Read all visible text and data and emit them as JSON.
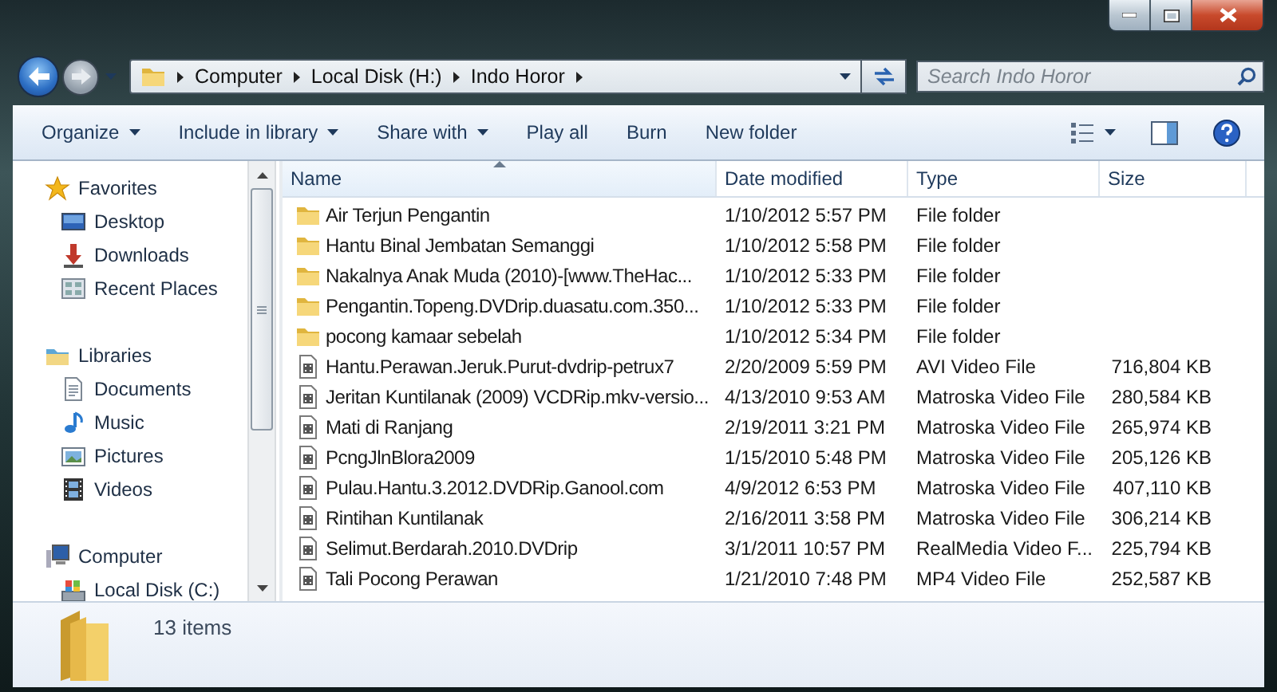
{
  "address_bar": {
    "breadcrumbs": [
      "Computer",
      "Local Disk (H:)",
      "Indo Horor"
    ]
  },
  "search": {
    "placeholder": "Search Indo Horor"
  },
  "toolbar": {
    "buttons": [
      {
        "label": "Organize",
        "dropdown": true
      },
      {
        "label": "Include in library",
        "dropdown": true
      },
      {
        "label": "Share with",
        "dropdown": true
      },
      {
        "label": "Play all",
        "dropdown": false
      },
      {
        "label": "Burn",
        "dropdown": false
      },
      {
        "label": "New folder",
        "dropdown": false
      }
    ]
  },
  "sidebar": {
    "groups": [
      {
        "label": "Favorites",
        "kind": "star",
        "children": [
          {
            "label": "Desktop",
            "kind": "desktop"
          },
          {
            "label": "Downloads",
            "kind": "download"
          },
          {
            "label": "Recent Places",
            "kind": "recent"
          }
        ]
      },
      {
        "label": "Libraries",
        "kind": "library",
        "children": [
          {
            "label": "Documents",
            "kind": "document"
          },
          {
            "label": "Music",
            "kind": "music"
          },
          {
            "label": "Pictures",
            "kind": "pictures"
          },
          {
            "label": "Videos",
            "kind": "videos"
          }
        ]
      },
      {
        "label": "Computer",
        "kind": "computer",
        "children": [
          {
            "label": "Local Disk (C:)",
            "kind": "disk"
          }
        ]
      }
    ]
  },
  "table": {
    "columns": [
      {
        "label": "Name",
        "sorted": true
      },
      {
        "label": "Date modified",
        "sorted": false
      },
      {
        "label": "Type",
        "sorted": false
      },
      {
        "label": "Size",
        "sorted": false
      }
    ],
    "rows": [
      {
        "kind": "folder",
        "name": "Air Terjun Pengantin",
        "date": "1/10/2012 5:57 PM",
        "type": "File folder"
      },
      {
        "kind": "folder",
        "name": "Hantu Binal Jembatan Semanggi",
        "date": "1/10/2012 5:58 PM",
        "type": "File folder"
      },
      {
        "kind": "folder",
        "name": "Nakalnya Anak Muda (2010)-[www.TheHac...",
        "date": "1/10/2012 5:33 PM",
        "type": "File folder"
      },
      {
        "kind": "folder",
        "name": "Pengantin.Topeng.DVDrip.duasatu.com.350...",
        "date": "1/10/2012 5:33 PM",
        "type": "File folder"
      },
      {
        "kind": "folder",
        "name": "pocong kamaar sebelah",
        "date": "1/10/2012 5:34 PM",
        "type": "File folder"
      },
      {
        "kind": "video",
        "name": "Hantu.Perawan.Jeruk.Purut-dvdrip-petrux7",
        "date": "2/20/2009 5:59 PM",
        "type": "AVI Video File",
        "size": "716,804 KB"
      },
      {
        "kind": "video",
        "name": "Jeritan Kuntilanak (2009) VCDRip.mkv-versio...",
        "date": "4/13/2010 9:53 AM",
        "type": "Matroska Video File",
        "size": "280,584 KB"
      },
      {
        "kind": "video",
        "name": "Mati di Ranjang",
        "date": "2/19/2011 3:21 PM",
        "type": "Matroska Video File",
        "size": "265,974 KB"
      },
      {
        "kind": "video",
        "name": "PcngJlnBlora2009",
        "date": "1/15/2010 5:48 PM",
        "type": "Matroska Video File",
        "size": "205,126 KB"
      },
      {
        "kind": "video",
        "name": "Pulau.Hantu.3.2012.DVDRip.Ganool.com",
        "date": "4/9/2012 6:53 PM",
        "type": "Matroska Video File",
        "size": "407,110 KB"
      },
      {
        "kind": "video",
        "name": "Rintihan Kuntilanak",
        "date": "2/16/2011 3:58 PM",
        "type": "Matroska Video File",
        "size": "306,214 KB"
      },
      {
        "kind": "video",
        "name": "Selimut.Berdarah.2010.DVDrip",
        "date": "3/1/2011 10:57 PM",
        "type": "RealMedia Video F...",
        "size": "225,794 KB"
      },
      {
        "kind": "video",
        "name": "Tali Pocong Perawan",
        "date": "1/21/2010 7:48 PM",
        "type": "MP4 Video File",
        "size": "252,587 KB"
      }
    ]
  },
  "details_pane": {
    "item_count": "13 items"
  }
}
